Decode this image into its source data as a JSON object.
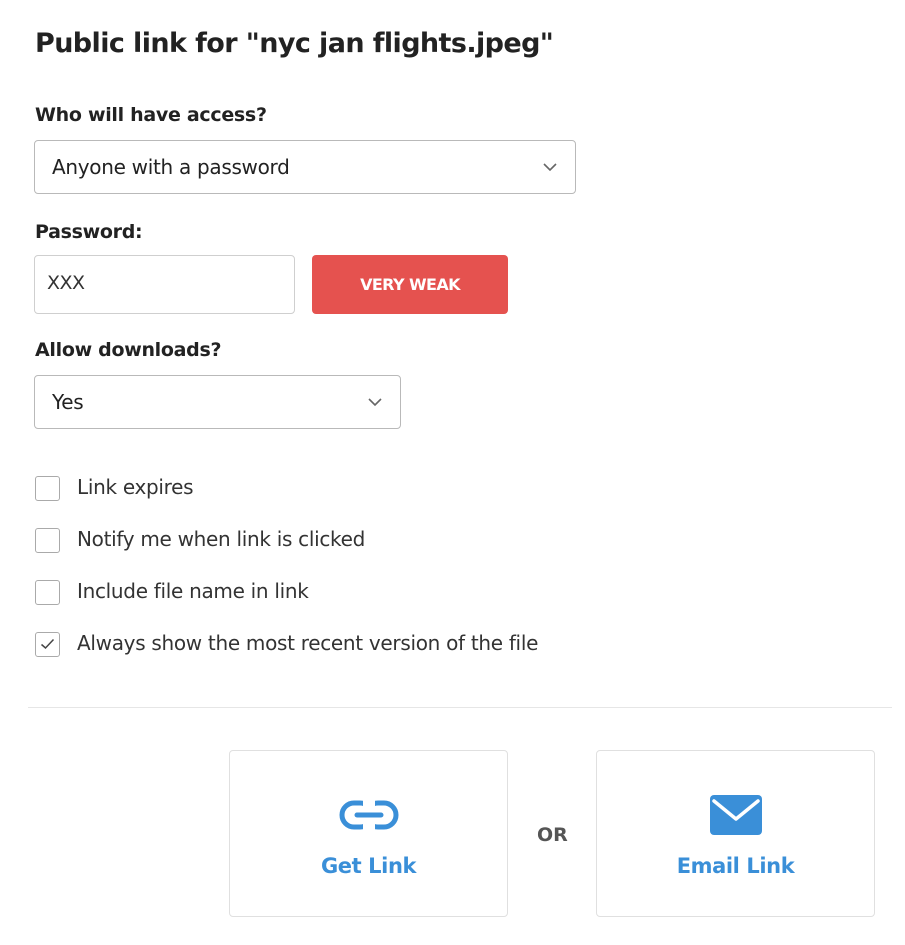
{
  "title": "Public link for \"nyc jan flights.jpeg\"",
  "access": {
    "label": "Who will have access?",
    "selected": "Anyone with a password"
  },
  "password": {
    "label": "Password:",
    "value": "XXX",
    "strength": "VERY WEAK"
  },
  "downloads": {
    "label": "Allow downloads?",
    "selected": "Yes"
  },
  "options": [
    {
      "label": "Link expires",
      "checked": false
    },
    {
      "label": "Notify me when link is clicked",
      "checked": false
    },
    {
      "label": "Include file name in link",
      "checked": false
    },
    {
      "label": "Always show the most recent version of the file",
      "checked": true
    }
  ],
  "actions": {
    "get_link": "Get Link",
    "or": "OR",
    "email_link": "Email Link"
  },
  "icons": {
    "get_link": "link-icon",
    "email_link": "envelope-icon"
  },
  "colors": {
    "accent": "#3a8fd8",
    "danger": "#e5524f"
  }
}
